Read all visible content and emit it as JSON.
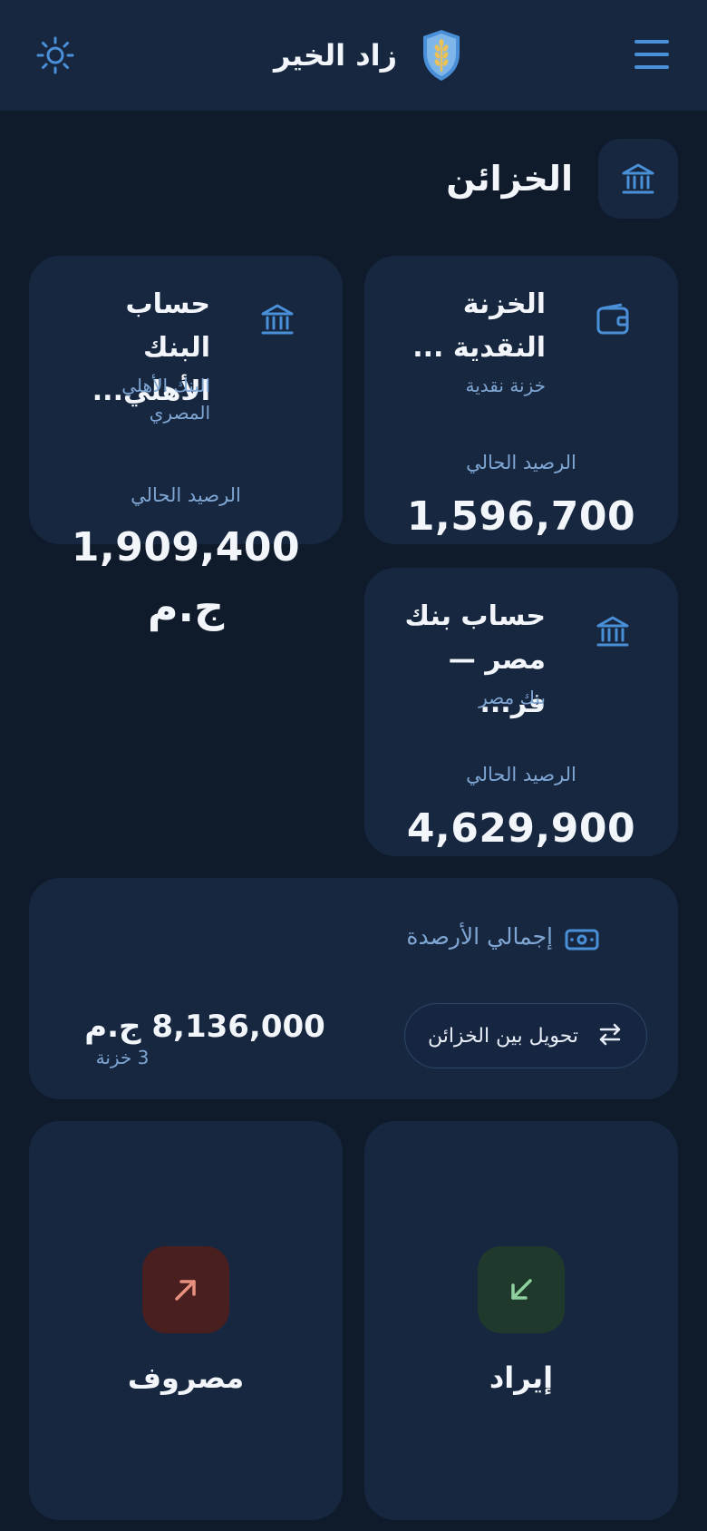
{
  "header": {
    "app_name": "زاد الخير",
    "menu_icon": "menu-icon",
    "theme_icon": "sun-icon",
    "logo_icon": "wheat-shield-logo"
  },
  "section": {
    "title": "الخزائن",
    "icon": "bank-icon"
  },
  "treasuries": [
    {
      "name": "الخزنة النقدية ...",
      "type": "خزنة نقدية",
      "balance_label": "الرصيد الحالي",
      "balance": "1,596,700",
      "icon": "wallet-icon"
    },
    {
      "name": "حساب البنك الأهلي...",
      "type": "البنك الأهلي المصري",
      "balance_label": "الرصيد الحالي",
      "balance": "1,909,400",
      "currency": "ج.م",
      "icon": "bank-icon"
    },
    {
      "name": "حساب بنك مصر — فر...",
      "type": "بنك مصر",
      "balance_label": "الرصيد الحالي",
      "balance": "4,629,900",
      "icon": "bank-icon"
    }
  ],
  "summary": {
    "label": "إجمالي الأرصدة",
    "total": "8,136,000 ج.م",
    "count": "3 خزنة",
    "transfer_label": "تحويل بين الخزائن",
    "icon": "cash-icon",
    "transfer_icon": "swap-arrows-icon"
  },
  "actions": {
    "income_label": "إيراد",
    "expense_label": "مصروف",
    "income_icon": "arrow-down-left-icon",
    "expense_icon": "arrow-up-right-icon"
  },
  "colors": {
    "background": "#0f1a2a",
    "card": "#172740",
    "accent": "#4a90d9",
    "muted_text": "#7fa6d3",
    "income": "#8fd19e",
    "income_bg": "#1f3a2c",
    "expense": "#e8907f",
    "expense_bg": "#4a1f1f"
  }
}
